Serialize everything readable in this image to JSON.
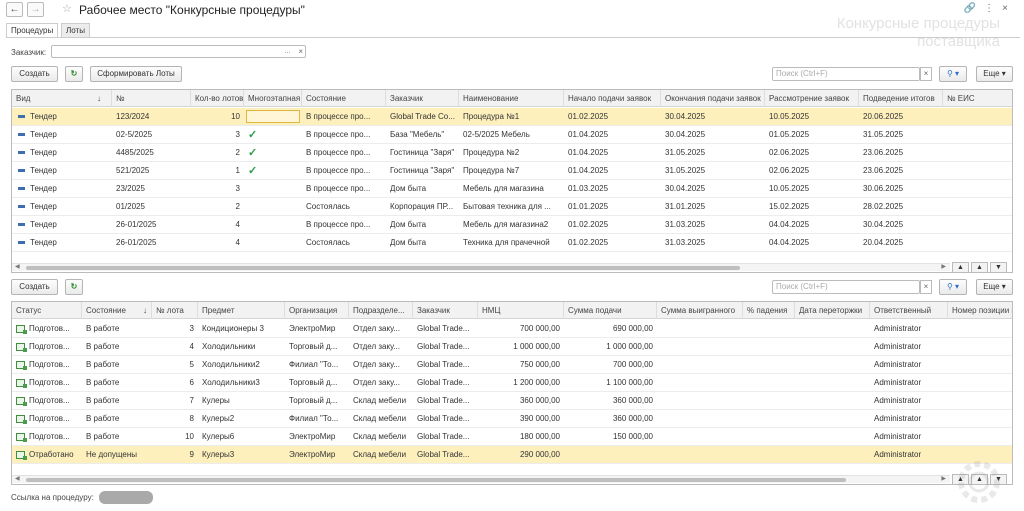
{
  "window": {
    "title": "Рабочее место \"Конкурсные процедуры\"",
    "watermark_line1": "Конкурсные процедуры",
    "watermark_line2": "поставщика"
  },
  "tabs": [
    {
      "label": "Процедуры"
    },
    {
      "label": "Лоты"
    }
  ],
  "filter": {
    "customer_label": "Заказчик:",
    "customer_value": ""
  },
  "toolbar1": {
    "create_label": "Создать",
    "form_lots_label": "Сформировать Лоты",
    "search_placeholder": "Поиск (Ctrl+F)",
    "more_label": "Еще"
  },
  "procedures": {
    "columns": [
      "Вид",
      "№",
      "Кол-во лотов",
      "Многоэтапная",
      "Состояние",
      "Заказчик",
      "Наименование",
      "Начало подачи заявок",
      "Окончания подачи заявок",
      "Рассмотрение заявок",
      "Подведение итогов",
      "№ ЕИС"
    ],
    "rows": [
      {
        "kind": "Тендер",
        "num": "123/2024",
        "lots": "10",
        "multi": false,
        "state": "В процессе про...",
        "customer": "Global Trade Co...",
        "name": "Процедура №1",
        "start": "01.02.2025",
        "end": "30.04.2025",
        "review": "10.05.2025",
        "results": "20.06.2025",
        "eis": "",
        "selected": true
      },
      {
        "kind": "Тендер",
        "num": "02-5/2025",
        "lots": "3",
        "multi": true,
        "state": "В процессе про...",
        "customer": "База \"Мебель\"",
        "name": "02-5/2025 Мебель",
        "start": "01.04.2025",
        "end": "30.04.2025",
        "review": "01.05.2025",
        "results": "31.05.2025",
        "eis": "",
        "selected": false
      },
      {
        "kind": "Тендер",
        "num": "4485/2025",
        "lots": "2",
        "multi": true,
        "state": "В процессе про...",
        "customer": "Гостиница \"Заря\"",
        "name": "Процедура №2",
        "start": "01.04.2025",
        "end": "31.05.2025",
        "review": "02.06.2025",
        "results": "23.06.2025",
        "eis": "",
        "selected": false
      },
      {
        "kind": "Тендер",
        "num": "521/2025",
        "lots": "1",
        "multi": true,
        "state": "В процессе про...",
        "customer": "Гостиница \"Заря\"",
        "name": "Процедура №7",
        "start": "01.04.2025",
        "end": "31.05.2025",
        "review": "02.06.2025",
        "results": "23.06.2025",
        "eis": "",
        "selected": false
      },
      {
        "kind": "Тендер",
        "num": "23/2025",
        "lots": "3",
        "multi": false,
        "state": "В процессе про...",
        "customer": "Дом быта",
        "name": "Мебель для магазина",
        "start": "01.03.2025",
        "end": "30.04.2025",
        "review": "10.05.2025",
        "results": "30.06.2025",
        "eis": "",
        "selected": false
      },
      {
        "kind": "Тендер",
        "num": "01/2025",
        "lots": "2",
        "multi": false,
        "state": "Состоялась",
        "customer": "Корпорация ПР...",
        "name": "Бытовая техника для ...",
        "start": "01.01.2025",
        "end": "31.01.2025",
        "review": "15.02.2025",
        "results": "28.02.2025",
        "eis": "",
        "selected": false
      },
      {
        "kind": "Тендер",
        "num": "26-01/2025",
        "lots": "4",
        "multi": false,
        "state": "В процессе про...",
        "customer": "Дом быта",
        "name": "Мебель для магазина2",
        "start": "01.02.2025",
        "end": "31.03.2025",
        "review": "04.04.2025",
        "results": "30.04.2025",
        "eis": "",
        "selected": false
      },
      {
        "kind": "Тендер",
        "num": "26-01/2025",
        "lots": "4",
        "multi": false,
        "state": "Состоялась",
        "customer": "Дом быта",
        "name": "Техника для прачечной",
        "start": "01.02.2025",
        "end": "31.03.2025",
        "review": "04.04.2025",
        "results": "20.04.2025",
        "eis": "",
        "selected": false
      }
    ]
  },
  "toolbar2": {
    "create_label": "Создать",
    "search_placeholder": "Поиск (Ctrl+F)",
    "more_label": "Еще"
  },
  "lots": {
    "columns": [
      "Статус",
      "Состояние",
      "№ лота",
      "Предмет",
      "Организация",
      "Подразделе...",
      "Заказчик",
      "НМЦ",
      "Сумма подачи",
      "Сумма выигранного",
      "% падения",
      "Дата переторжки",
      "Ответственный",
      "Номер позиции п"
    ],
    "rows": [
      {
        "status": "Подготов...",
        "state": "В работе",
        "lot": "3",
        "subject": "Кондиционеры 3",
        "org": "ЭлектроМир",
        "dept": "Отдел заку...",
        "customer": "Global Trade...",
        "nmc": "700 000,00",
        "submit": "690 000,00",
        "won": "",
        "drop": "",
        "rebid": "",
        "resp": "Administrator",
        "pos": "",
        "selected": false
      },
      {
        "status": "Подготов...",
        "state": "В работе",
        "lot": "4",
        "subject": "Холодильники",
        "org": "Торговый д...",
        "dept": "Отдел заку...",
        "customer": "Global Trade...",
        "nmc": "1 000 000,00",
        "submit": "1 000 000,00",
        "won": "",
        "drop": "",
        "rebid": "",
        "resp": "Administrator",
        "pos": "",
        "selected": false
      },
      {
        "status": "Подготов...",
        "state": "В работе",
        "lot": "5",
        "subject": "Холодильники2",
        "org": "Филиал \"То...",
        "dept": "Отдел заку...",
        "customer": "Global Trade...",
        "nmc": "750 000,00",
        "submit": "700 000,00",
        "won": "",
        "drop": "",
        "rebid": "",
        "resp": "Administrator",
        "pos": "",
        "selected": false
      },
      {
        "status": "Подготов...",
        "state": "В работе",
        "lot": "6",
        "subject": "Холодильники3",
        "org": "Торговый д...",
        "dept": "Отдел заку...",
        "customer": "Global Trade...",
        "nmc": "1 200 000,00",
        "submit": "1 100 000,00",
        "won": "",
        "drop": "",
        "rebid": "",
        "resp": "Administrator",
        "pos": "",
        "selected": false
      },
      {
        "status": "Подготов...",
        "state": "В работе",
        "lot": "7",
        "subject": "Кулеры",
        "org": "Торговый д...",
        "dept": "Склад мебели",
        "customer": "Global Trade...",
        "nmc": "360 000,00",
        "submit": "360 000,00",
        "won": "",
        "drop": "",
        "rebid": "",
        "resp": "Administrator",
        "pos": "",
        "selected": false
      },
      {
        "status": "Подготов...",
        "state": "В работе",
        "lot": "8",
        "subject": "Кулеры2",
        "org": "Филиал \"То...",
        "dept": "Склад мебели",
        "customer": "Global Trade...",
        "nmc": "390 000,00",
        "submit": "360 000,00",
        "won": "",
        "drop": "",
        "rebid": "",
        "resp": "Administrator",
        "pos": "",
        "selected": false
      },
      {
        "status": "Подготов...",
        "state": "В работе",
        "lot": "10",
        "subject": "Кулеры6",
        "org": "ЭлектроМир",
        "dept": "Склад мебели",
        "customer": "Global Trade...",
        "nmc": "180 000,00",
        "submit": "150 000,00",
        "won": "",
        "drop": "",
        "rebid": "",
        "resp": "Administrator",
        "pos": "",
        "selected": false
      },
      {
        "status": "Отработано",
        "state": "Не допущены",
        "lot": "9",
        "subject": "Кулеры3",
        "org": "ЭлектроМир",
        "dept": "Склад мебели",
        "customer": "Global Trade...",
        "nmc": "290 000,00",
        "submit": "",
        "won": "",
        "drop": "",
        "rebid": "",
        "resp": "Administrator",
        "pos": "",
        "selected": true
      }
    ]
  },
  "footer": {
    "link_label": "Ссылка на процедуру:"
  }
}
